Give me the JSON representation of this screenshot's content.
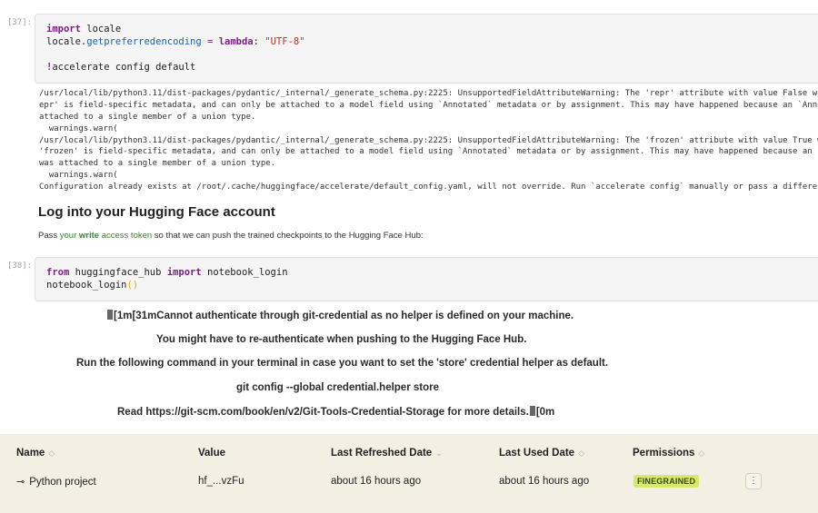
{
  "cell37": {
    "prompt": "[37]:",
    "code": [
      "import locale",
      "locale.getpreferredencoding = lambda: \"UTF-8\"",
      "",
      "!accelerate config default"
    ]
  },
  "stderr": [
    "/usr/local/lib/python3.11/dist-packages/pydantic/_internal/_generate_schema.py:2225: UnsupportedFieldAttributeWarning: The 'repr' attribute with value False was",
    "epr' is field-specific metadata, and can only be attached to a model field using `Annotated` metadata or by assignment. This may have happened because an `Annot",
    "attached to a single member of a union type.",
    "  warnings.warn(",
    "/usr/local/lib/python3.11/dist-packages/pydantic/_internal/_generate_schema.py:2225: UnsupportedFieldAttributeWarning: The 'frozen' attribute with value True wa",
    "'frozen' is field-specific metadata, and can only be attached to a model field using `Annotated` metadata or by assignment. This may have happened because an `A",
    "was attached to a single member of a union type.",
    "  warnings.warn(",
    "Configuration already exists at /root/.cache/huggingface/accelerate/default_config.yaml, will not override. Run `accelerate config` manually or pass a different"
  ],
  "markdown": {
    "heading": "Log into your Hugging Face account",
    "para_prefix": "Pass ",
    "para_link1": "your ",
    "para_bold": "write",
    "para_link2": " access token",
    "para_suffix": " so that we can push the trained checkpoints to the Hugging Face Hub:"
  },
  "cell38": {
    "prompt": "[38]:",
    "code": [
      "from huggingface_hub import notebook_login",
      "notebook_login()"
    ]
  },
  "output": {
    "line1": "[1m[31mCannot authenticate through git-credential as no helper is defined on your machine.",
    "line2": "You might have to re-authenticate when pushing to the Hugging Face Hub.",
    "line3": "Run the following command in your terminal in case you want to set the 'store' credential helper as default.",
    "line4": "git config --global credential.helper store",
    "line5": "Read https://git-scm.com/book/en/v2/Git-Tools-Credential-Storage for more details.",
    "line5_tail": "[0m"
  },
  "tokens_table": {
    "headers": {
      "name": "Name",
      "value": "Value",
      "last_refreshed": "Last Refreshed Date",
      "last_used": "Last Used Date",
      "permissions": "Permissions"
    },
    "row": {
      "name": "Python project",
      "value": "hf_...vzFu",
      "last_refreshed": "about 16 hours ago",
      "last_used": "about 16 hours ago",
      "permission": "FINEGRAINED"
    },
    "icons": {
      "key": "key-icon",
      "sort": "sort-icon",
      "menu": "kebab-menu-icon"
    }
  }
}
